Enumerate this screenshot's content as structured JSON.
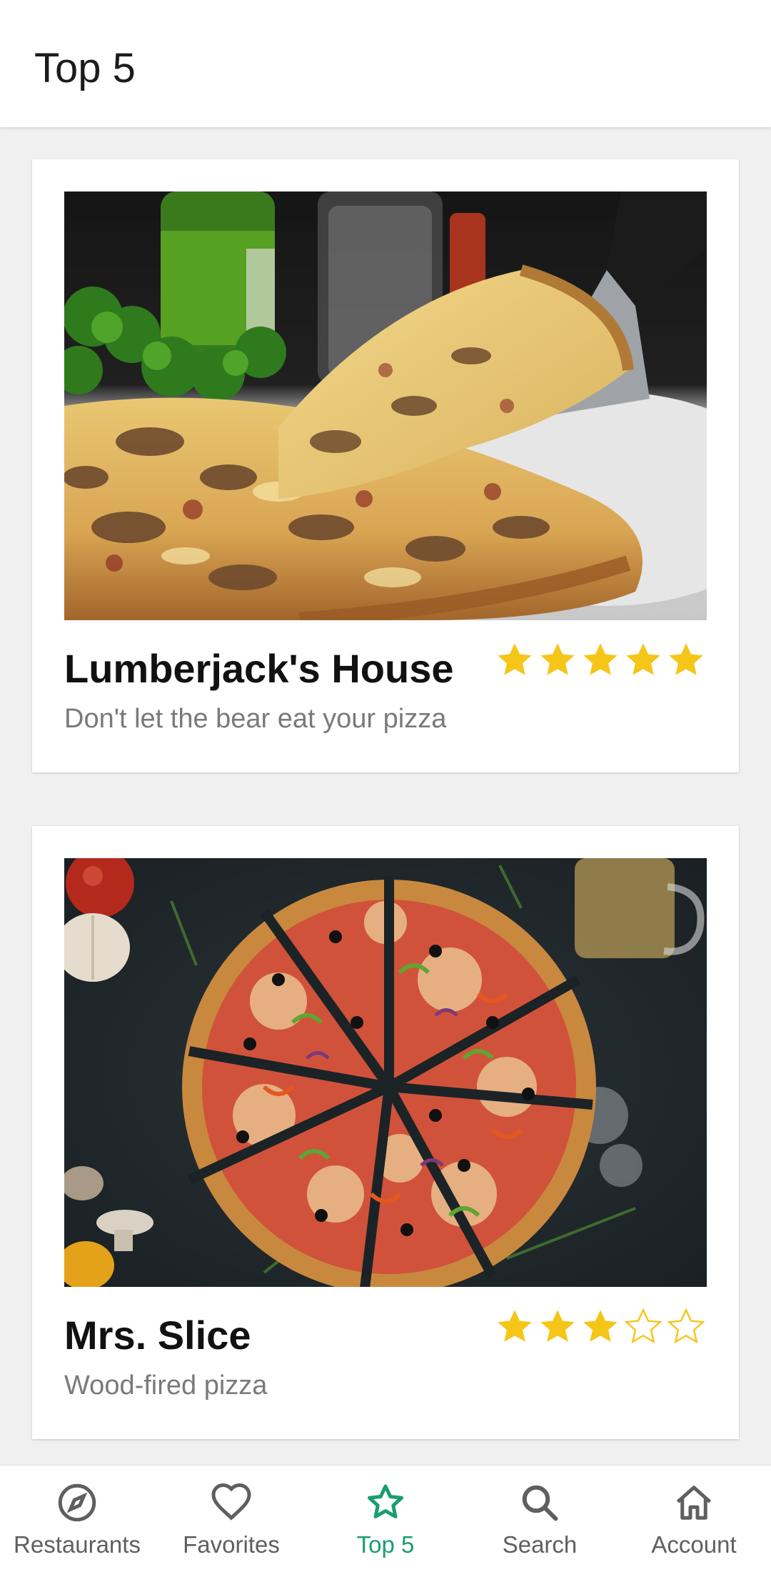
{
  "app": {
    "title": "Top 5"
  },
  "colors": {
    "accent": "#1a9e6e",
    "star": "#f5c518",
    "nav_inactive": "#5f5f5f",
    "subtitle": "#7a7a7a"
  },
  "restaurants": [
    {
      "name": "Lumberjack's House",
      "tagline": "Don't let the bear eat your pizza",
      "rating": 5,
      "rating_max": 5,
      "image": "pizza-slice-on-spatula-photo"
    },
    {
      "name": "Mrs. Slice",
      "tagline": "Wood-fired pizza",
      "rating": 3,
      "rating_max": 5,
      "image": "sliced-pizza-top-down-photo"
    }
  ],
  "nav": {
    "active": "Top 5",
    "items": [
      {
        "label": "Restaurants",
        "icon": "compass-icon"
      },
      {
        "label": "Favorites",
        "icon": "heart-icon"
      },
      {
        "label": "Top 5",
        "icon": "star-icon"
      },
      {
        "label": "Search",
        "icon": "search-icon"
      },
      {
        "label": "Account",
        "icon": "home-icon"
      }
    ]
  }
}
